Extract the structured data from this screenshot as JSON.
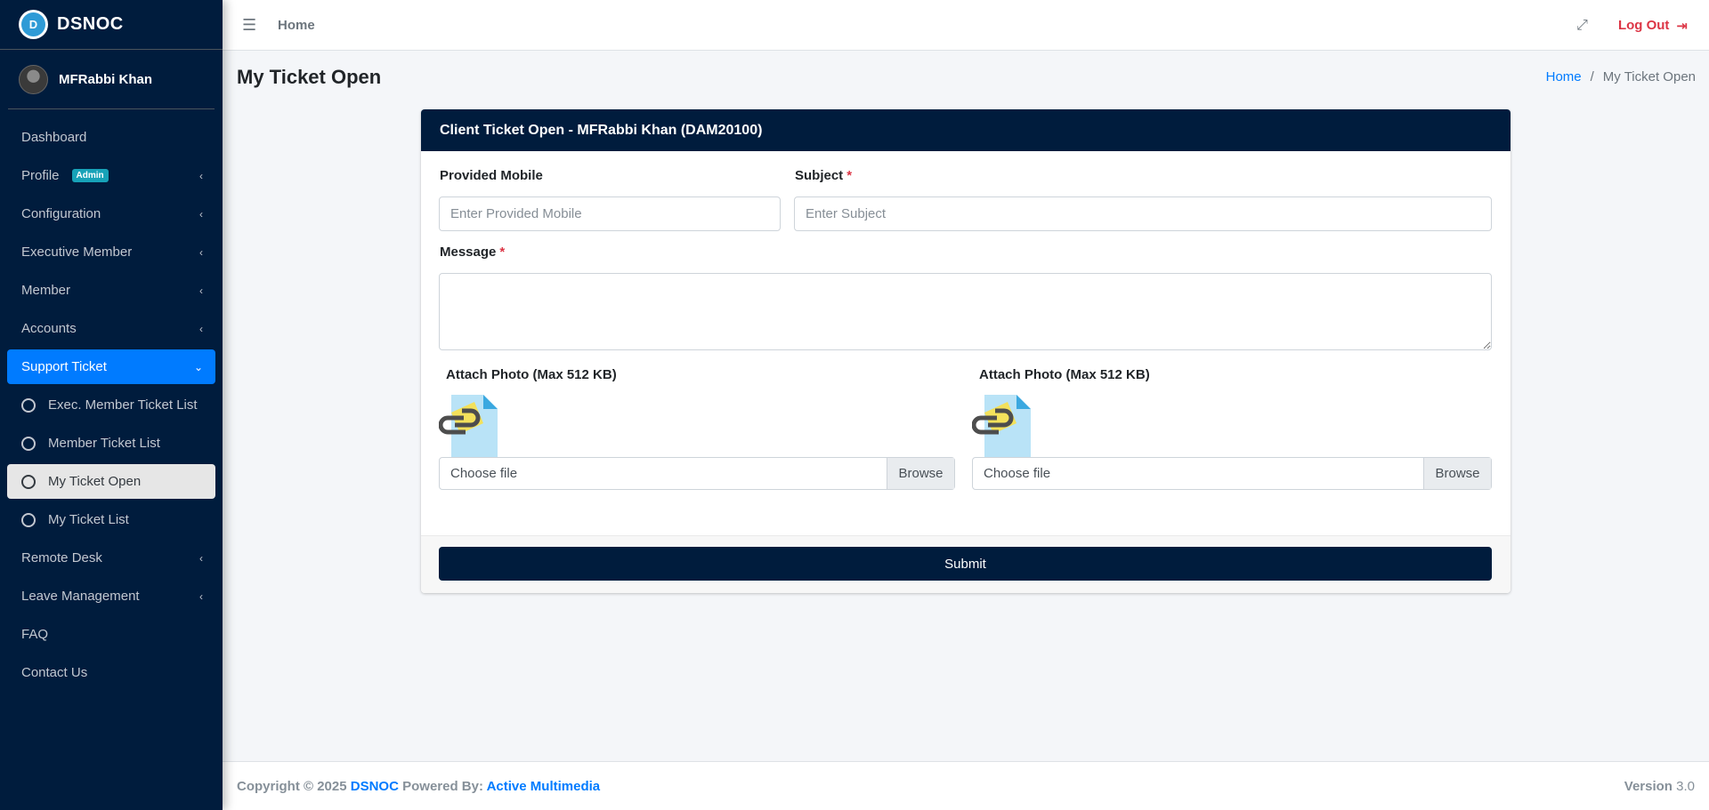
{
  "brand": {
    "name": "DSNOC",
    "logo_text": "D"
  },
  "user": {
    "name": "MFRabbi Khan"
  },
  "sidebar": {
    "items": [
      {
        "label": "Dashboard",
        "chevron": ""
      },
      {
        "label": "Profile",
        "badge": "Admin",
        "chevron": "‹"
      },
      {
        "label": "Configuration",
        "chevron": "‹"
      },
      {
        "label": "Executive Member",
        "chevron": "‹"
      },
      {
        "label": "Member",
        "chevron": "‹"
      },
      {
        "label": "Accounts",
        "chevron": "‹"
      },
      {
        "label": "Support Ticket",
        "chevron": "⌄"
      }
    ],
    "sub_items": [
      {
        "label": "Exec. Member Ticket List"
      },
      {
        "label": "Member Ticket List"
      },
      {
        "label": "My Ticket Open"
      },
      {
        "label": "My Ticket List"
      }
    ],
    "items_after": [
      {
        "label": "Remote Desk",
        "chevron": "‹"
      },
      {
        "label": "Leave Management",
        "chevron": "‹"
      },
      {
        "label": "FAQ",
        "chevron": ""
      },
      {
        "label": "Contact Us",
        "chevron": ""
      }
    ]
  },
  "topbar": {
    "menu_icon": "☰",
    "home_label": "Home",
    "expand_icon": "⤢",
    "logout_label": "Log Out",
    "logout_icon": "⇥"
  },
  "page": {
    "title": "My Ticket Open",
    "breadcrumb": {
      "home": "Home",
      "separator": "/",
      "current": "My Ticket Open"
    }
  },
  "card": {
    "title": "Client Ticket Open - MFRabbi Khan (DAM20100)",
    "form": {
      "mobile_label": "Provided Mobile",
      "mobile_placeholder": "Enter Provided Mobile",
      "subject_label": "Subject",
      "subject_placeholder": "Enter Subject",
      "message_label": "Message",
      "required_mark": "*",
      "attach1_label": "Attach Photo (Max 512 KB)",
      "attach2_label": "Attach Photo (Max 512 KB)",
      "file1_text": "Choose file",
      "file2_text": "Choose file",
      "browse_label": "Browse",
      "submit_label": "Submit"
    }
  },
  "footer": {
    "copyright": "Copyright © 2025",
    "brand": "DSNOC",
    "powered": "Powered By:",
    "company": "Active Multimedia",
    "version_label": "Version",
    "version": "3.0"
  },
  "colors": {
    "sidebar_bg": "#001c3d",
    "active_blue": "#007bff",
    "logout_red": "#dc3545",
    "badge_teal": "#17a2b8"
  }
}
